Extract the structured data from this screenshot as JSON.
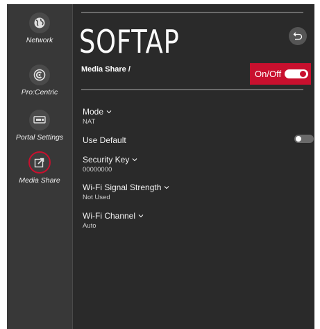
{
  "sidebar": {
    "items": [
      {
        "label": "Network",
        "icon": "globe-icon"
      },
      {
        "label": "Pro:Centric",
        "icon": "procentric-icon"
      },
      {
        "label": "Portal Settings",
        "icon": "portal-icon"
      },
      {
        "label": "Media Share",
        "icon": "media-share-icon",
        "active": true
      }
    ]
  },
  "header": {
    "title": "SOFTAP",
    "breadcrumb": "Media Share /",
    "back_icon": "back-arrow-icon",
    "onoff": {
      "label": "On/Off",
      "state": "on"
    }
  },
  "settings": [
    {
      "name": "Mode",
      "value": "NAT",
      "dropdown": true
    },
    {
      "name": "Use Default",
      "value": "",
      "toggle": "off"
    },
    {
      "name": "Security Key",
      "value": "00000000",
      "dropdown": true
    },
    {
      "name": "Wi-Fi Signal Strength",
      "value": "Not Used",
      "dropdown": true
    },
    {
      "name": "Wi-Fi Channel",
      "value": "Auto",
      "dropdown": true
    }
  ],
  "colors": {
    "accent": "#c8102e",
    "background": "#2a2a2a",
    "sidebar": "#383838"
  }
}
